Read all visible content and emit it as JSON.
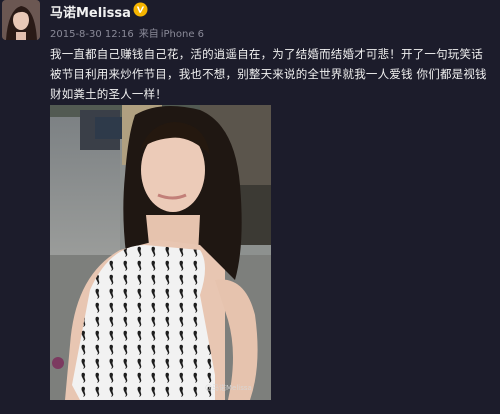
{
  "post": {
    "author": "马诺Melissa",
    "timestamp": "2015-8-30 12:16",
    "source_prefix": "来自",
    "source": "iPhone 6",
    "text": "我一直都自己赚钱自己花，活的逍遥自在，为了结婚而结婚才可悲！开了一句玩笑话被节目利用来炒作节目，我也不想，别整天来说的全世界就我一人爱钱 你们都是视钱财如粪土的圣人一样！",
    "watermark": "@马诺Melissa"
  },
  "colors": {
    "background": "#1c1c2b",
    "verified_badge": "#f5b400",
    "meta_text": "#8a8a98"
  },
  "icons": {
    "verified": "verified-v-badge-icon"
  }
}
